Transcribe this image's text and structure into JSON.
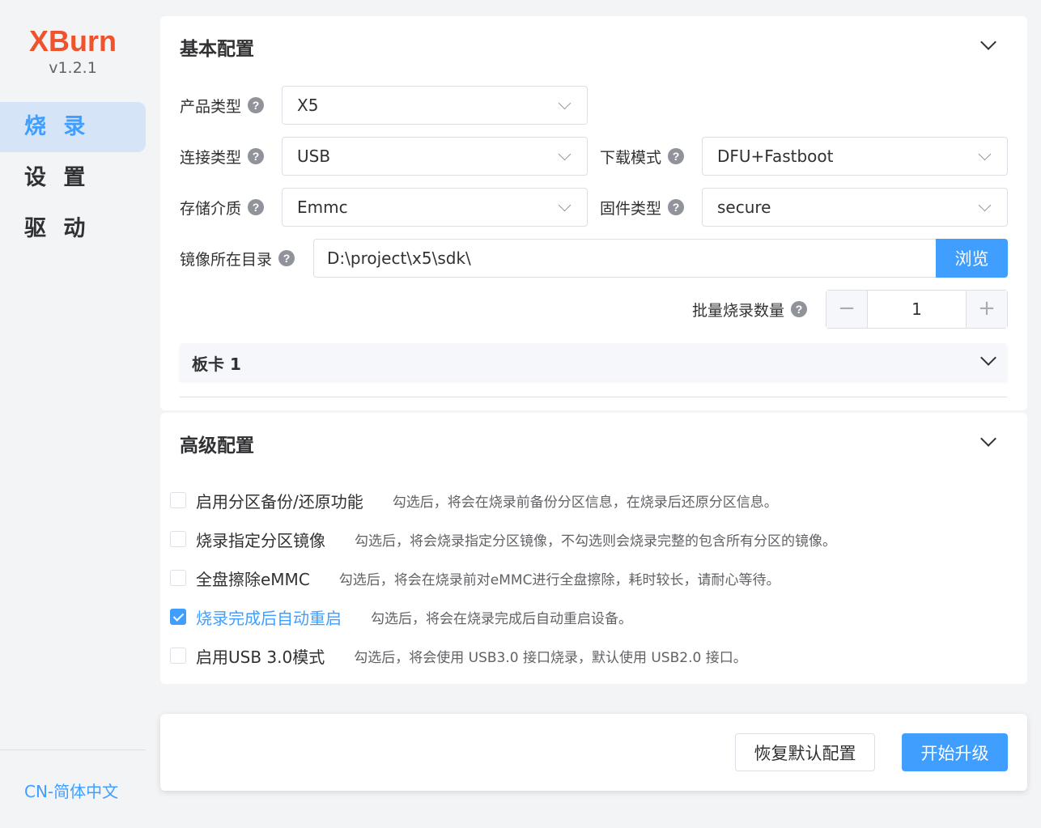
{
  "sidebar": {
    "logo": "XBurn",
    "version": "v1.2.1",
    "nav": [
      "烧 录",
      "设 置",
      "驱 动"
    ],
    "language": "CN-简体中文"
  },
  "basic": {
    "title": "基本配置",
    "product_type": {
      "label": "产品类型",
      "value": "X5"
    },
    "connect_type": {
      "label": "连接类型",
      "value": "USB"
    },
    "download_mode": {
      "label": "下载模式",
      "value": "DFU+Fastboot"
    },
    "storage": {
      "label": "存储介质",
      "value": "Emmc"
    },
    "firmware_type": {
      "label": "固件类型",
      "value": "secure"
    },
    "image_dir": {
      "label": "镜像所在目录",
      "value": "D:\\project\\x5\\sdk\\",
      "browse": "浏览"
    },
    "batch": {
      "label": "批量烧录数量",
      "value": "1",
      "minus": "−",
      "plus": "+"
    },
    "board_title": "板卡 1",
    "help_glyph": "?"
  },
  "advanced": {
    "title": "高级配置",
    "options": [
      {
        "label": "启用分区备份/还原功能",
        "desc": "勾选后，将会在烧录前备份分区信息，在烧录后还原分区信息。",
        "checked": false
      },
      {
        "label": "烧录指定分区镜像",
        "desc": "勾选后，将会烧录指定分区镜像，不勾选则会烧录完整的包含所有分区的镜像。",
        "checked": false
      },
      {
        "label": "全盘擦除eMMC",
        "desc": "勾选后，将会在烧录前对eMMC进行全盘擦除，耗时较长，请耐心等待。",
        "checked": false
      },
      {
        "label": "烧录完成后自动重启",
        "desc": "勾选后，将会在烧录完成后自动重启设备。",
        "checked": true
      },
      {
        "label": "启用USB 3.0模式",
        "desc": "勾选后，将会使用 USB3.0 接口烧录，默认使用 USB2.0 接口。",
        "checked": false
      }
    ]
  },
  "footer": {
    "reset": "恢复默认配置",
    "start": "开始升级"
  },
  "colors": {
    "accent": "#409eff",
    "logo": "#f0522b"
  }
}
